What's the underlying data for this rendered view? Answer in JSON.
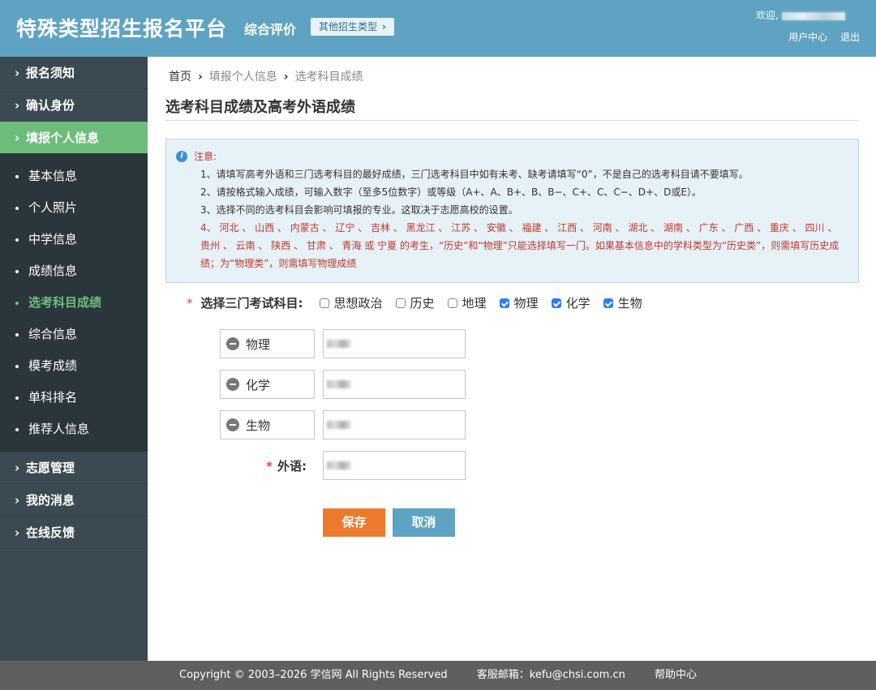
{
  "header": {
    "title": "特殊类型招生报名平台",
    "subtitle": "综合评价",
    "other_types_label": "其他招生类型",
    "welcome_label": "欢迎,",
    "user_center": "用户中心",
    "logout": "退出"
  },
  "sidebar": {
    "top_items": [
      {
        "label": "报名须知"
      },
      {
        "label": "确认身份"
      },
      {
        "label": "填报个人信息"
      }
    ],
    "sub_items": [
      {
        "label": "基本信息"
      },
      {
        "label": "个人照片"
      },
      {
        "label": "中学信息"
      },
      {
        "label": "成绩信息"
      },
      {
        "label": "选考科目成绩"
      },
      {
        "label": "综合信息"
      },
      {
        "label": "模考成绩"
      },
      {
        "label": "单科排名"
      },
      {
        "label": "推荐人信息"
      }
    ],
    "bottom_items": [
      {
        "label": "志愿管理"
      },
      {
        "label": "我的消息"
      },
      {
        "label": "在线反馈"
      }
    ]
  },
  "breadcrumb": {
    "home": "首页",
    "level2": "填报个人信息",
    "level3": "选考科目成绩"
  },
  "page_title": "选考科目成绩及高考外语成绩",
  "notice": {
    "heading": "注意:",
    "line1": "1、请填写高考外语和三门选考科目的最好成绩，三门选考科目中如有未考、缺考请填写“0”，不是自己的选考科目请不要填写。",
    "line2": "2、请按格式输入成绩，可输入数字（至多5位数字）或等级（A+、A、B+、B、B−、C+、C、C−、D+、D或E）。",
    "line3": "3、选择不同的选考科目会影响可填报的专业。这取决于志愿高校的设置。",
    "line4": "4、 河北 、 山西 、 内蒙古 、 辽宁 、 吉林 、 黑龙江 、 江苏 、 安徽 、 福建 、 江西 、 河南 、 湖北 、 湖南 、 广东 、 广西 、 重庆 、 四川 、 贵州 、 云南 、 陕西 、 甘肃 、 青海 或 宁夏 的考生，“历史”和“物理”只能选择填写一门。如果基本信息中的学科类型为“历史类”，则需填写历史成绩；为“物理类”，则需填写物理成绩"
  },
  "subjects": {
    "required_mark": "*",
    "label": "选择三门考试科目:",
    "options": [
      {
        "label": "思想政治",
        "checked": false
      },
      {
        "label": "历史",
        "checked": false
      },
      {
        "label": "地理",
        "checked": false
      },
      {
        "label": "物理",
        "checked": true
      },
      {
        "label": "化学",
        "checked": true
      },
      {
        "label": "生物",
        "checked": true
      }
    ]
  },
  "scores": [
    {
      "subject": "物理"
    },
    {
      "subject": "化学"
    },
    {
      "subject": "生物"
    }
  ],
  "foreign": {
    "required_mark": "*",
    "label": "外语:"
  },
  "buttons": {
    "save": "保存",
    "cancel": "取消"
  },
  "footer": {
    "copyright": "Copyright © 2003–2026 学信网 All Rights Reserved",
    "email": "客服邮箱：kefu@chsi.com.cn",
    "help": "帮助中心"
  },
  "colors": {
    "header_bg": "#5fa3c2",
    "sidebar_bg": "#3b4a52",
    "active_green": "#6dbd7a",
    "save_orange": "#ec7a2d",
    "notice_red": "#c0392b"
  }
}
